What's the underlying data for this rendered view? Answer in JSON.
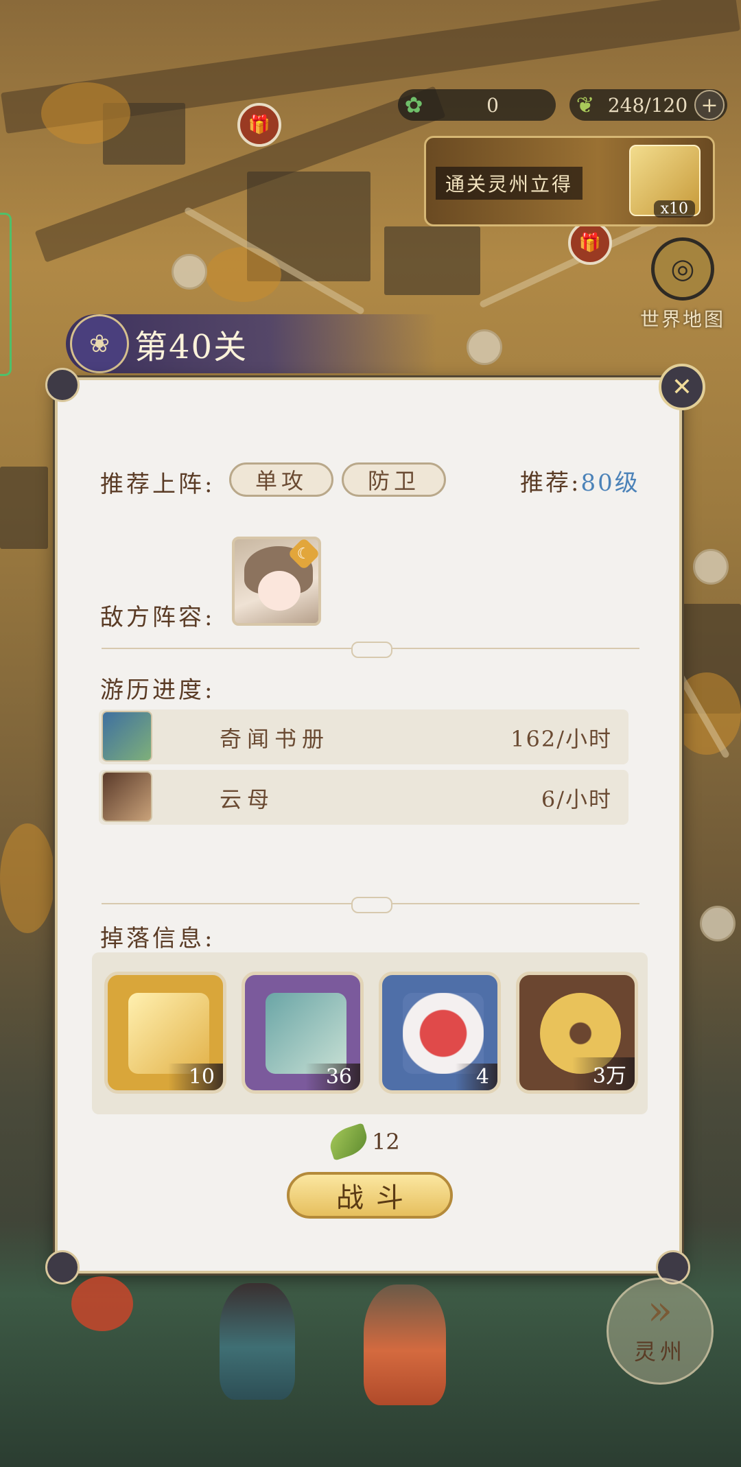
{
  "resources": {
    "bamboo_value": "0",
    "stamina_value": "248/120",
    "plus_label": "+"
  },
  "reward_banner": {
    "text": "通关灵州立得",
    "count": "x10"
  },
  "world_map": {
    "label": "世界地图",
    "icon": "world-map-icon"
  },
  "stage": {
    "title": "第40关",
    "emblem_icon": "stage-emblem-icon"
  },
  "panel": {
    "close_icon": "close-icon",
    "recommend_label": "推荐上阵:",
    "roles": [
      "单攻",
      "防卫"
    ],
    "recommend_level_label": "推荐:",
    "recommend_level_value": "80级",
    "enemy_label": "敌方阵容:",
    "progress_label": "游历进度:",
    "progress": [
      {
        "name": "奇闻书册",
        "rate": "162/小时",
        "icon": "book-icon"
      },
      {
        "name": "云母",
        "rate": "6/小时",
        "icon": "mica-icon"
      }
    ],
    "drops_label": "掉落信息:",
    "drops": [
      {
        "qty": "10",
        "icon": "golden-scroll-icon",
        "color": "#d9a63a"
      },
      {
        "qty": "36",
        "icon": "purple-book-icon",
        "color": "#7b5a9c"
      },
      {
        "qty": "4",
        "icon": "red-bowl-icon",
        "color": "#4f6fa8"
      },
      {
        "qty": "3万",
        "icon": "copper-coin-icon",
        "color": "#6b4630"
      }
    ],
    "cost": "12",
    "cost_icon": "leaf-stamina-icon",
    "fight_label": "战斗"
  },
  "bottom": {
    "region_label": "灵州",
    "region_icon": "fast-forward-icon"
  }
}
